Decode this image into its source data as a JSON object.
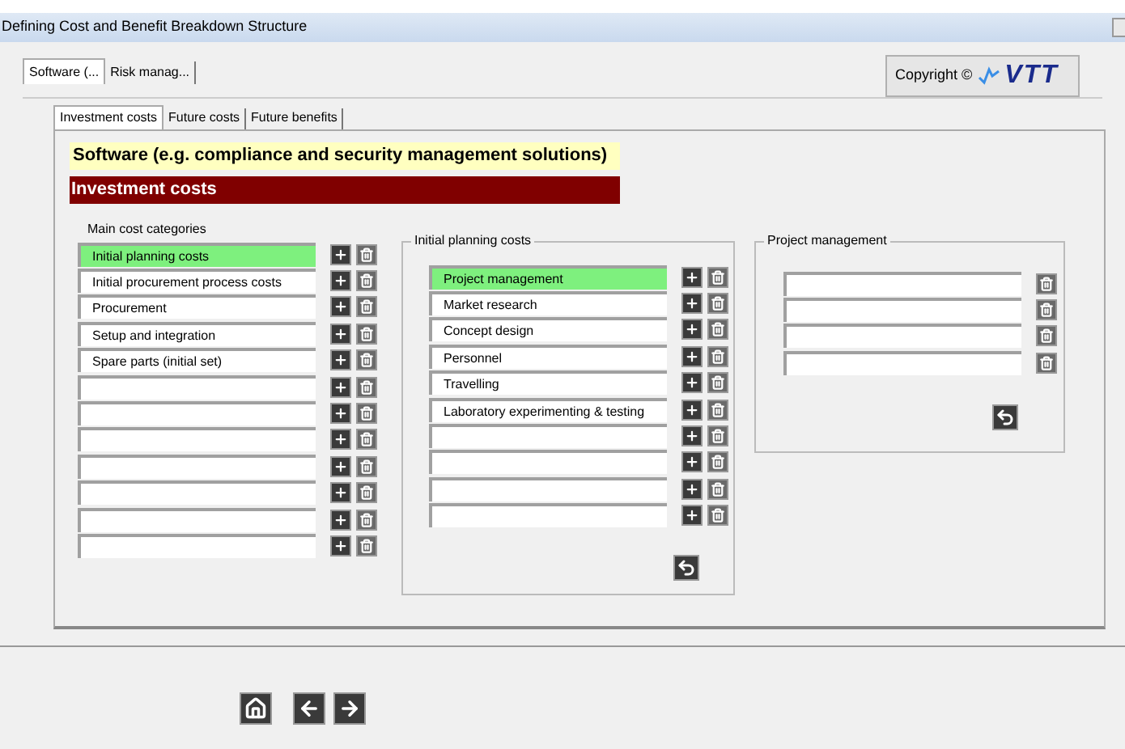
{
  "window": {
    "title": "Defining Cost and Benefit Breakdown Structure"
  },
  "outer_tabs": [
    {
      "label": "Software (...",
      "selected": true
    },
    {
      "label": "Risk manag...",
      "selected": false
    }
  ],
  "copyright": {
    "text": "Copyright ©",
    "logo": "VTT"
  },
  "inner_tabs": [
    {
      "label": "Investment costs",
      "selected": true
    },
    {
      "label": "Future costs",
      "selected": false
    },
    {
      "label": "Future benefits",
      "selected": false
    }
  ],
  "heading": "Software (e.g. compliance and security management solutions)",
  "section_title": "Investment costs",
  "main_categories": {
    "label": "Main cost categories",
    "rows": [
      {
        "value": "Initial planning costs",
        "selected": true
      },
      {
        "value": "Initial procurement process costs",
        "selected": false
      },
      {
        "value": "Procurement",
        "selected": false
      },
      {
        "value": "Setup and integration",
        "selected": false
      },
      {
        "value": "Spare parts (initial set)",
        "selected": false
      },
      {
        "selected": false
      },
      {
        "selected": false
      },
      {
        "selected": false
      },
      {
        "selected": false
      },
      {
        "selected": false
      },
      {
        "selected": false
      },
      {
        "selected": false
      }
    ]
  },
  "initial_planning": {
    "title": "Initial planning costs",
    "rows": [
      {
        "value": "Project management",
        "selected": true
      },
      {
        "value": "Market research",
        "selected": false
      },
      {
        "value": "Concept design",
        "selected": false
      },
      {
        "value": "Personnel",
        "selected": false
      },
      {
        "value": "Travelling",
        "selected": false
      },
      {
        "value": "Laboratory experimenting & testing",
        "selected": false
      },
      {
        "selected": false
      },
      {
        "selected": false
      },
      {
        "selected": false
      },
      {
        "selected": false
      }
    ]
  },
  "project_management": {
    "title": "Project management",
    "rows": [
      {
        "selected": false
      },
      {
        "selected": false
      },
      {
        "selected": false
      },
      {
        "selected": false
      }
    ]
  }
}
